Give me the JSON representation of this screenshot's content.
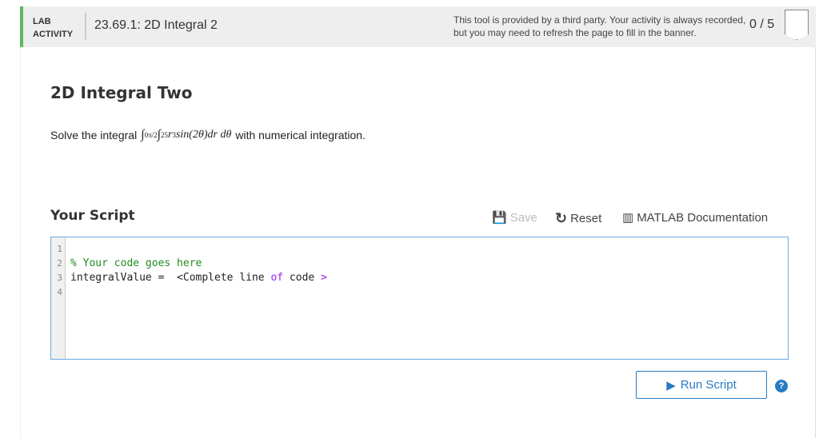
{
  "header": {
    "lab_line1": "LAB",
    "lab_line2": "ACTIVITY",
    "title": "23.69.1: 2D Integral 2",
    "notice_line1": "This tool is provided by a third party. Your activity is always recorded,",
    "notice_line2": "but you may need to refresh the page to fill in the banner.",
    "score": "0 / 5"
  },
  "main": {
    "heading": "2D Integral Two",
    "prompt_before": "Solve the integral",
    "prompt_after": "with numerical integration.",
    "math": {
      "int1_upper": "π/2",
      "int1_lower": "0",
      "int2_upper": "5",
      "int2_lower": "2",
      "integrand": "r",
      "power": "3",
      "rest": "sin(2θ)dr dθ"
    }
  },
  "script": {
    "heading": "Your Script",
    "save": "Save",
    "reset": "Reset",
    "docs": "MATLAB Documentation",
    "run": "Run Script",
    "help": "?",
    "line_numbers": [
      "1",
      "2",
      "3",
      "4"
    ],
    "line2": "% Your code goes here",
    "line3_a": "integralValue =  <Complete line ",
    "line3_kw": "of",
    "line3_b": " code ",
    "line3_gt": ">"
  }
}
